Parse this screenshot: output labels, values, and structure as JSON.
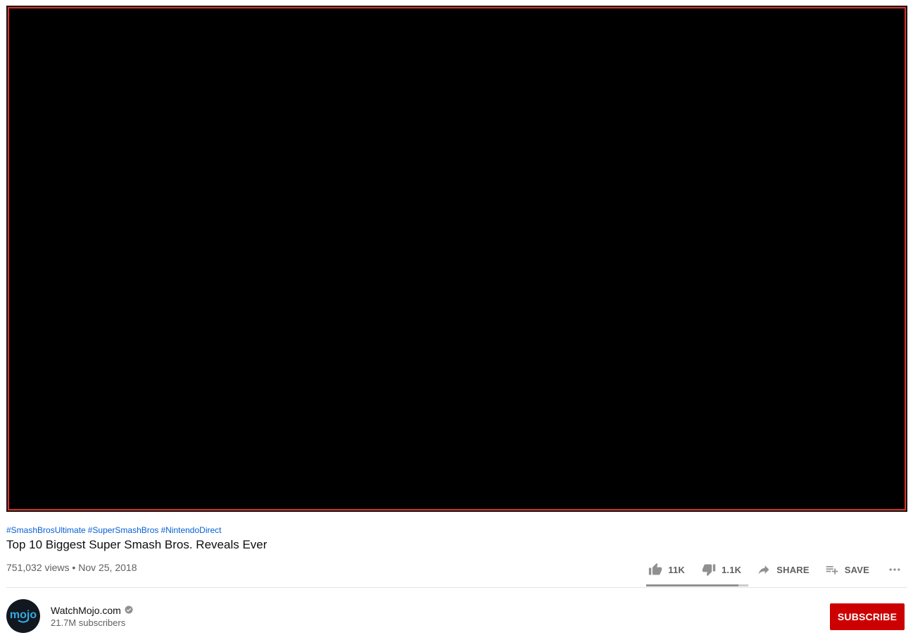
{
  "player": {
    "border_color": "#d9332c",
    "background_color": "#000000"
  },
  "video": {
    "hashtags": [
      "#SmashBrosUltimate",
      "#SuperSmashBros",
      "#NintendoDirect"
    ],
    "title": "Top 10 Biggest Super Smash Bros. Reveals Ever",
    "views": "751,032 views",
    "separator": "•",
    "date": "Nov 25, 2018"
  },
  "actions": {
    "likes": "11K",
    "dislikes": "1.1K",
    "share_label": "SHARE",
    "save_label": "SAVE",
    "like_ratio": 0.9,
    "icons": [
      "thumb-up-icon",
      "thumb-down-icon",
      "share-arrow-icon",
      "playlist-add-icon",
      "more-horizontal-icon"
    ]
  },
  "channel": {
    "name": "WatchMojo.com",
    "subscribers": "21.7M subscribers",
    "verified_icon": "verified-check-icon",
    "avatar_logo": "mojo",
    "avatar_color": "#111820",
    "logo_color": "#35a9e0"
  },
  "subscribe": {
    "label": "SUBSCRIBE",
    "color": "#cc0000"
  }
}
